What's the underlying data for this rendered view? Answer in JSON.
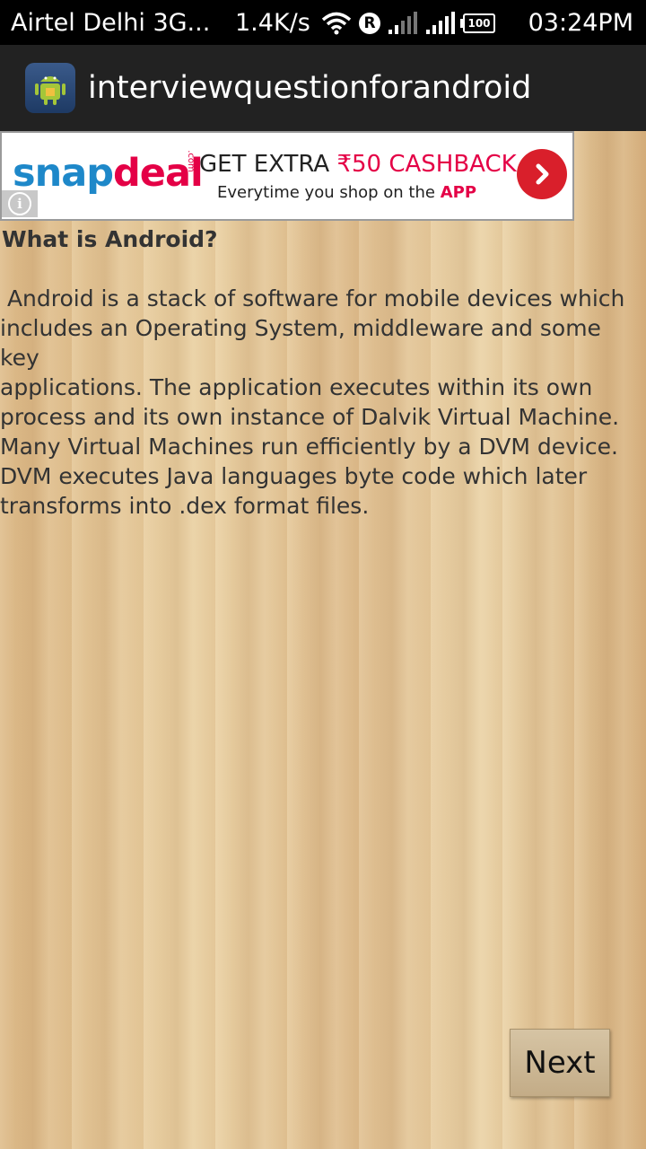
{
  "status_bar": {
    "carrier": "Airtel Delhi 3G...",
    "speed": "1.4K/s",
    "roaming_badge": "R",
    "battery_level": "100",
    "time": "03:24PM",
    "icons": [
      "wifi-icon",
      "roaming-icon",
      "signal-icon",
      "signal-icon",
      "battery-icon"
    ]
  },
  "action_bar": {
    "title": "interviewquestionforandroid",
    "icon": "android-app-icon"
  },
  "ad": {
    "logo_main": "snapdeal",
    "logo_sub": ".com",
    "headline_prefix": "GET EXTRA",
    "headline_offer": "₹50 CASHBACK",
    "tagline_prefix": "Everytime you shop on the",
    "tagline_app": "APP",
    "arrow_icon": "chevron-right-icon",
    "info_icon": "info-icon",
    "brand_color": "#e40046",
    "accent_blue": "#1e88c9"
  },
  "content": {
    "question": "What is Android?",
    "answer": " Android is a stack of software for mobile devices which\nincludes an Operating System, middleware and some key\napplications. The application executes within its own\nprocess and its own instance of Dalvik Virtual Machine.\nMany Virtual Machines run efficiently by a DVM device.\nDVM executes Java languages byte code which later\ntransforms into .dex format files."
  },
  "navigation": {
    "next_label": "Next"
  }
}
